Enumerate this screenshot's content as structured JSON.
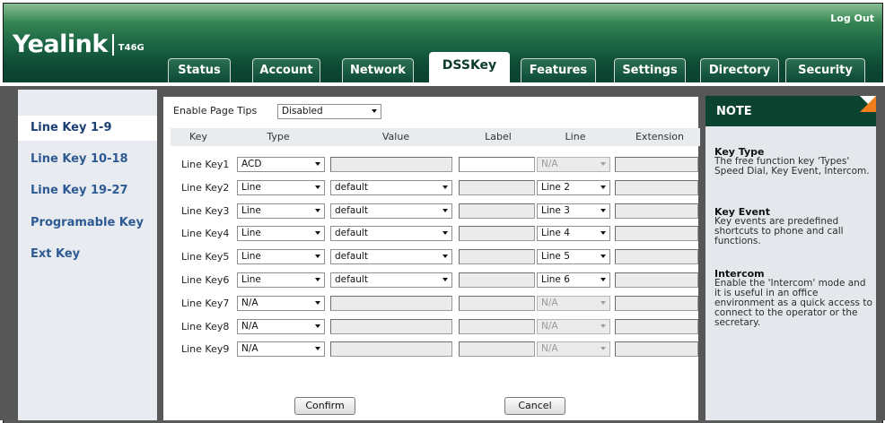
{
  "header": {
    "logout": "Log Out",
    "brand": "Yealink",
    "model": "T46G"
  },
  "tabs": [
    {
      "label": "Status"
    },
    {
      "label": "Account"
    },
    {
      "label": "Network"
    },
    {
      "label": "DSSKey",
      "active": true
    },
    {
      "label": "Features"
    },
    {
      "label": "Settings"
    },
    {
      "label": "Directory"
    },
    {
      "label": "Security"
    }
  ],
  "sidebar": {
    "items": [
      {
        "label": "Line Key 1-9",
        "active": true
      },
      {
        "label": "Line Key 10-18"
      },
      {
        "label": "Line Key 19-27"
      },
      {
        "label": "Programable Key"
      },
      {
        "label": "Ext Key"
      }
    ]
  },
  "page_tips": {
    "label": "Enable Page Tips",
    "value": "Disabled"
  },
  "table": {
    "columns": [
      "Key",
      "Type",
      "Value",
      "Label",
      "Line",
      "Extension"
    ],
    "rows": [
      {
        "key": "Line Key1",
        "type": "ACD",
        "value": "",
        "label": "",
        "line": "N/A",
        "value_enabled": false,
        "label_enabled": true,
        "line_enabled": false
      },
      {
        "key": "Line Key2",
        "type": "Line",
        "value": "default",
        "label": "",
        "line": "Line 2",
        "value_enabled": true,
        "label_enabled": false,
        "line_enabled": true
      },
      {
        "key": "Line Key3",
        "type": "Line",
        "value": "default",
        "label": "",
        "line": "Line 3",
        "value_enabled": true,
        "label_enabled": false,
        "line_enabled": true
      },
      {
        "key": "Line Key4",
        "type": "Line",
        "value": "default",
        "label": "",
        "line": "Line 4",
        "value_enabled": true,
        "label_enabled": false,
        "line_enabled": true
      },
      {
        "key": "Line Key5",
        "type": "Line",
        "value": "default",
        "label": "",
        "line": "Line 5",
        "value_enabled": true,
        "label_enabled": false,
        "line_enabled": true
      },
      {
        "key": "Line Key6",
        "type": "Line",
        "value": "default",
        "label": "",
        "line": "Line 6",
        "value_enabled": true,
        "label_enabled": false,
        "line_enabled": true
      },
      {
        "key": "Line Key7",
        "type": "N/A",
        "value": "",
        "label": "",
        "line": "N/A",
        "value_enabled": false,
        "label_enabled": false,
        "line_enabled": false
      },
      {
        "key": "Line Key8",
        "type": "N/A",
        "value": "",
        "label": "",
        "line": "N/A",
        "value_enabled": false,
        "label_enabled": false,
        "line_enabled": false
      },
      {
        "key": "Line Key9",
        "type": "N/A",
        "value": "",
        "label": "",
        "line": "N/A",
        "value_enabled": false,
        "label_enabled": false,
        "line_enabled": false
      }
    ]
  },
  "buttons": {
    "confirm": "Confirm",
    "cancel": "Cancel"
  },
  "note": {
    "title": "NOTE",
    "sections": [
      {
        "title": "Key Type",
        "text": "The free function key 'Types' Speed Dial, Key Event, Intercom."
      },
      {
        "title": "Key Event",
        "text": "Key events are predefined shortcuts to phone and call functions."
      },
      {
        "title": "Intercom",
        "text": "Enable the 'Intercom' mode and it is useful in an office environment as a quick access to connect to the operator or the secretary."
      }
    ]
  },
  "colors": {
    "header_dark": "#0b4230",
    "accent_orange": "#f07d1c",
    "sidebar_link": "#2e5a94"
  }
}
